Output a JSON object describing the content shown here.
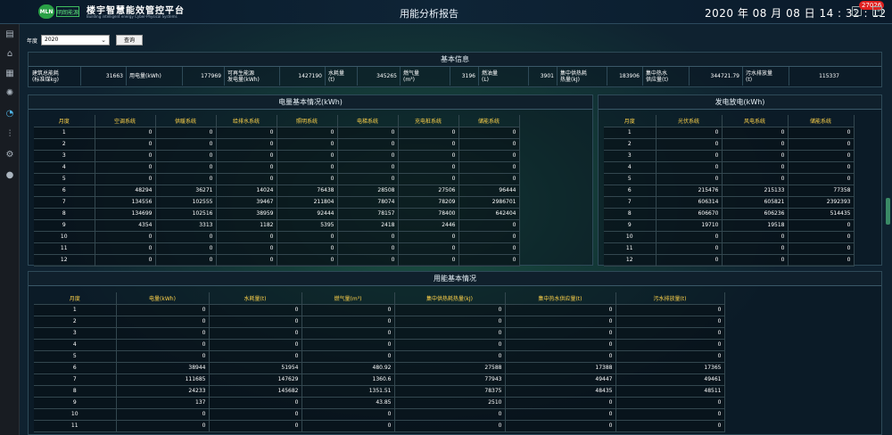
{
  "header": {
    "logo_text": "MLN",
    "logo_badge": "明朗能源",
    "app_title": "楼宇智慧能效管控平台",
    "app_subtitle": "Building intelligent energy Cyber-Physical Systems",
    "page_title": "用能分析报告",
    "datetime": "2020 年 08 月 08 日   14 : 32 : 12",
    "notification_count": "27026"
  },
  "sidebar": {
    "items": [
      "building-icon",
      "home-icon",
      "chart-icon",
      "lightbulb-icon",
      "pie-chart-icon",
      "sliders-icon",
      "gear-icon",
      "user-icon"
    ],
    "active_index": 4
  },
  "toolbar": {
    "year_label": "年度",
    "year_value": "2020",
    "query_label": "查询"
  },
  "basic_info": {
    "title": "基本信息",
    "items": [
      {
        "label": "建筑总能耗\n(标准煤kg)",
        "value": "31663"
      },
      {
        "label": "用电量(kWh)",
        "value": "177969"
      },
      {
        "label": "可再生能源\n发电量(kWh)",
        "value": "1427190"
      },
      {
        "label": "水耗量\n(t)",
        "value": "345265"
      },
      {
        "label": "燃气量\n(m³)",
        "value": "3196"
      },
      {
        "label": "燃油量\n(L)",
        "value": "3901"
      },
      {
        "label": "集中供热耗\n热量(kJ)",
        "value": "183906"
      },
      {
        "label": "集中热水\n供应量(t)",
        "value": "344721.79"
      },
      {
        "label": "污水排放量\n(t)",
        "value": "115337"
      }
    ]
  },
  "electricity": {
    "title": "电量基本情况(kWh)",
    "headers": [
      "月度",
      "空调系统",
      "供暖系统",
      "给排水系统",
      "照明系统",
      "电梯系统",
      "充电桩系统",
      "储能系统"
    ],
    "rows": [
      [
        "1",
        "0",
        "0",
        "0",
        "0",
        "0",
        "0",
        "0"
      ],
      [
        "2",
        "0",
        "0",
        "0",
        "0",
        "0",
        "0",
        "0"
      ],
      [
        "3",
        "0",
        "0",
        "0",
        "0",
        "0",
        "0",
        "0"
      ],
      [
        "4",
        "0",
        "0",
        "0",
        "0",
        "0",
        "0",
        "0"
      ],
      [
        "5",
        "0",
        "0",
        "0",
        "0",
        "0",
        "0",
        "0"
      ],
      [
        "6",
        "48294",
        "36271",
        "14024",
        "76438",
        "28508",
        "27506",
        "96444"
      ],
      [
        "7",
        "134556",
        "102555",
        "39467",
        "211804",
        "78074",
        "78209",
        "2986701"
      ],
      [
        "8",
        "134699",
        "102516",
        "38959",
        "92444",
        "78157",
        "78400",
        "642404"
      ],
      [
        "9",
        "4354",
        "3313",
        "1182",
        "5395",
        "2418",
        "2446",
        "0"
      ],
      [
        "10",
        "0",
        "0",
        "0",
        "0",
        "0",
        "0",
        "0"
      ],
      [
        "11",
        "0",
        "0",
        "0",
        "0",
        "0",
        "0",
        "0"
      ],
      [
        "12",
        "0",
        "0",
        "0",
        "0",
        "0",
        "0",
        "0"
      ]
    ]
  },
  "generation": {
    "title": "发电放电(kWh)",
    "headers": [
      "月度",
      "光伏系统",
      "风电系统",
      "储能系统"
    ],
    "rows": [
      [
        "1",
        "0",
        "0",
        "0"
      ],
      [
        "2",
        "0",
        "0",
        "0"
      ],
      [
        "3",
        "0",
        "0",
        "0"
      ],
      [
        "4",
        "0",
        "0",
        "0"
      ],
      [
        "5",
        "0",
        "0",
        "0"
      ],
      [
        "6",
        "215476",
        "215133",
        "77358"
      ],
      [
        "7",
        "606314",
        "605821",
        "2392393"
      ],
      [
        "8",
        "606670",
        "606236",
        "514435"
      ],
      [
        "9",
        "19710",
        "19518",
        "0"
      ],
      [
        "10",
        "0",
        "0",
        "0"
      ],
      [
        "11",
        "0",
        "0",
        "0"
      ],
      [
        "12",
        "0",
        "0",
        "0"
      ]
    ]
  },
  "usage": {
    "title": "用能基本情况",
    "headers": [
      "月度",
      "电量(kWh)",
      "水耗量(t)",
      "燃气量(m³)",
      "集中供热耗热量(kJ)",
      "集中热水供应量(t)",
      "污水排放量(t)"
    ],
    "rows": [
      [
        "1",
        "0",
        "0",
        "0",
        "0",
        "0",
        "0"
      ],
      [
        "2",
        "0",
        "0",
        "0",
        "0",
        "0",
        "0"
      ],
      [
        "3",
        "0",
        "0",
        "0",
        "0",
        "0",
        "0"
      ],
      [
        "4",
        "0",
        "0",
        "0",
        "0",
        "0",
        "0"
      ],
      [
        "5",
        "0",
        "0",
        "0",
        "0",
        "0",
        "0"
      ],
      [
        "6",
        "38944",
        "51954",
        "480.92",
        "27588",
        "17388",
        "17365"
      ],
      [
        "7",
        "111685",
        "147629",
        "1360.6",
        "77943",
        "49447",
        "49461"
      ],
      [
        "8",
        "24233",
        "145682",
        "1351.51",
        "78375",
        "48435",
        "48511"
      ],
      [
        "9",
        "137",
        "0",
        "43.85",
        "2510",
        "0",
        "0"
      ],
      [
        "10",
        "0",
        "0",
        "0",
        "0",
        "0",
        "0"
      ],
      [
        "11",
        "0",
        "0",
        "0",
        "0",
        "0",
        "0"
      ]
    ]
  }
}
